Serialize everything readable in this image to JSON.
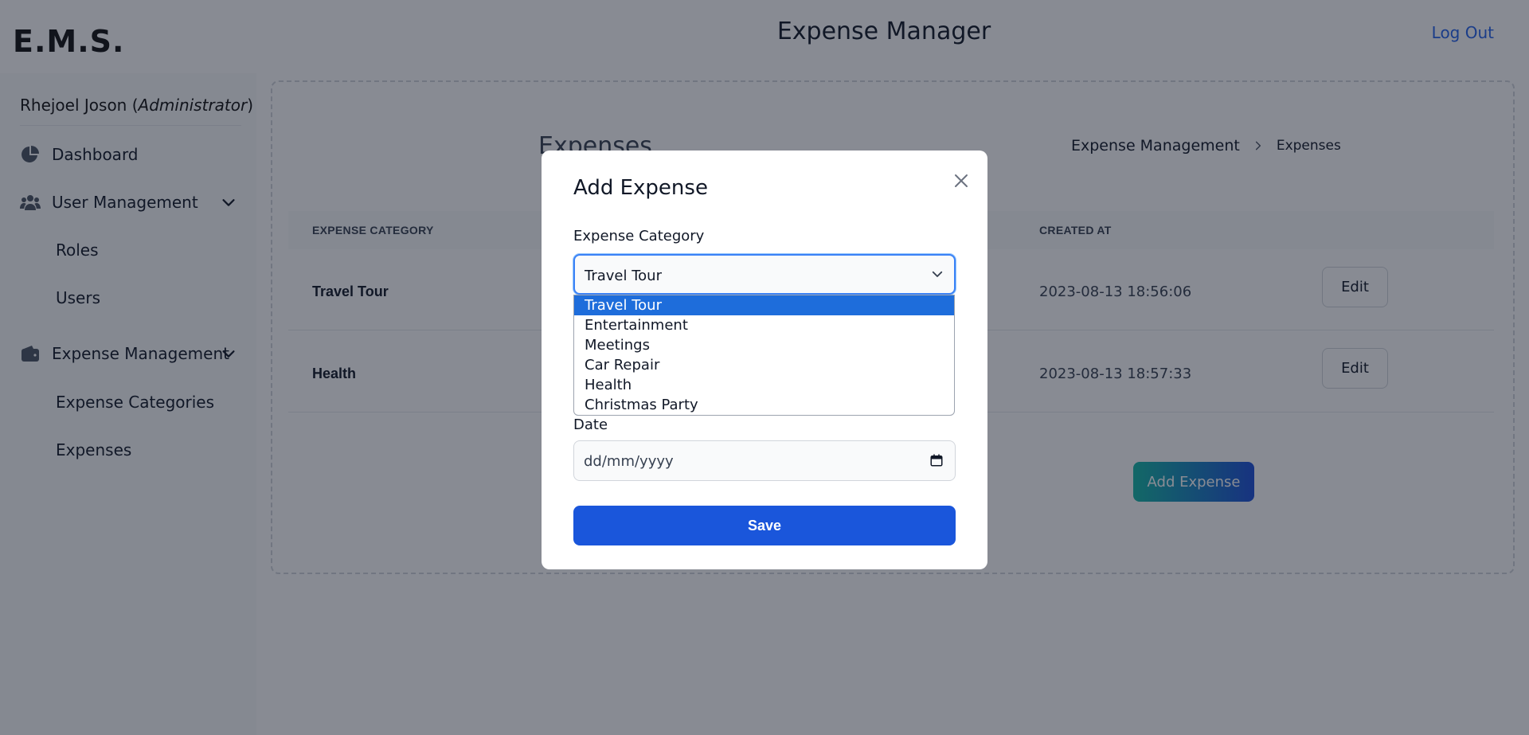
{
  "header": {
    "logo": "E.M.S.",
    "title": "Expense Manager",
    "logout_label": "Log Out"
  },
  "sidebar": {
    "user_name": "Rhejoel Joson",
    "user_role": "Administrator",
    "items": [
      {
        "label": "Dashboard",
        "icon": "pie-chart-icon"
      },
      {
        "label": "User Management",
        "icon": "users-icon"
      },
      {
        "label": "Roles"
      },
      {
        "label": "Users"
      },
      {
        "label": "Expense Management",
        "icon": "wallet-icon"
      },
      {
        "label": "Expense Categories"
      },
      {
        "label": "Expenses"
      }
    ]
  },
  "main": {
    "heading": "Expenses",
    "breadcrumb": [
      "Expense Management",
      "Expenses"
    ],
    "columns": {
      "category": "EXPENSE CATEGORY",
      "created_at": "CREATED AT"
    },
    "rows": [
      {
        "category": "Travel Tour",
        "created_at": "2023-08-13 18:56:06",
        "action": "Edit"
      },
      {
        "category": "Health",
        "created_at": "2023-08-13 18:57:33",
        "action": "Edit"
      }
    ],
    "add_label": "Add Expense"
  },
  "modal": {
    "title": "Add Expense",
    "category_label": "Expense Category",
    "category_value": "Travel Tour",
    "category_options": [
      "Travel Tour",
      "Entertainment",
      "Meetings",
      "Car Repair",
      "Health",
      "Christmas Party"
    ],
    "selected_option": "Travel Tour",
    "date_label": "Date",
    "date_placeholder": "dd/mm/yyyy",
    "save_label": "Save"
  },
  "colors": {
    "accent": "#1a56db",
    "link": "#2563eb",
    "selection": "#1e6ddb",
    "overlay": "rgba(17,24,39,0.5)"
  }
}
